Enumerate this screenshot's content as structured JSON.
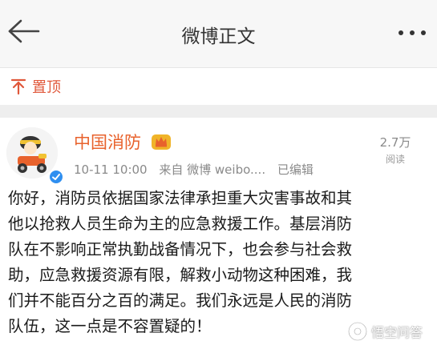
{
  "header": {
    "title": "微博正文"
  },
  "pinned": {
    "label": "置顶"
  },
  "post": {
    "author": "中国消防",
    "time": "10-11 10:00",
    "source": "来自 微博 weibo....",
    "edited": "已编辑",
    "reads_count": "2.7万",
    "reads_label": "阅读",
    "lines": [
      "你好，消防员依据国家法律承担重大灾害事故和其",
      "他以抢救人员生命为主的应急救援工作。基层消防",
      "队在不影响正常执勤战备情况下，也会参与社会救",
      "助，应急救援资源有限，解救小动物这种困难，我",
      "们并不能百分之百的满足。我们永远是人民的消防",
      "队伍，这一点是不容置疑的！"
    ]
  },
  "watermark": {
    "text": "悟空问答"
  },
  "colors": {
    "accent": "#e8622c",
    "pin": "#e0573a",
    "verified": "#2f8ff0"
  }
}
